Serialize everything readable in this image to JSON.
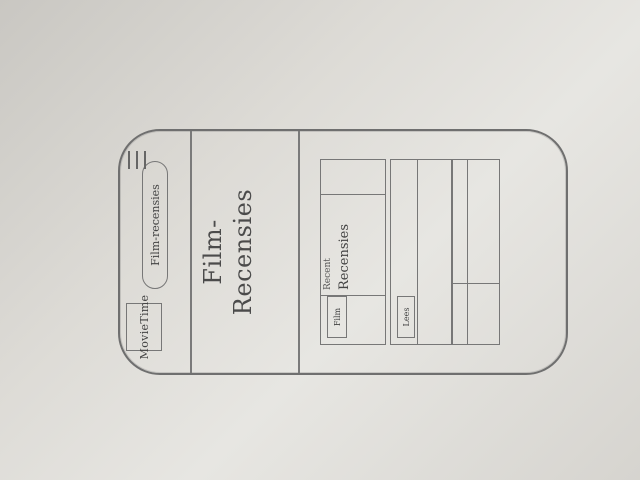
{
  "app": {
    "brand": "MovieTime",
    "search_text": "Film-recensies"
  },
  "page": {
    "title_line1": "Film-",
    "title_line2": "Recensies"
  },
  "cards": {
    "film_card": {
      "tag": "Film",
      "sub": "Recent",
      "label": "Recensies"
    },
    "second_card": {
      "badge": "Lees"
    }
  },
  "icons": {
    "menu": "menu-icon"
  }
}
